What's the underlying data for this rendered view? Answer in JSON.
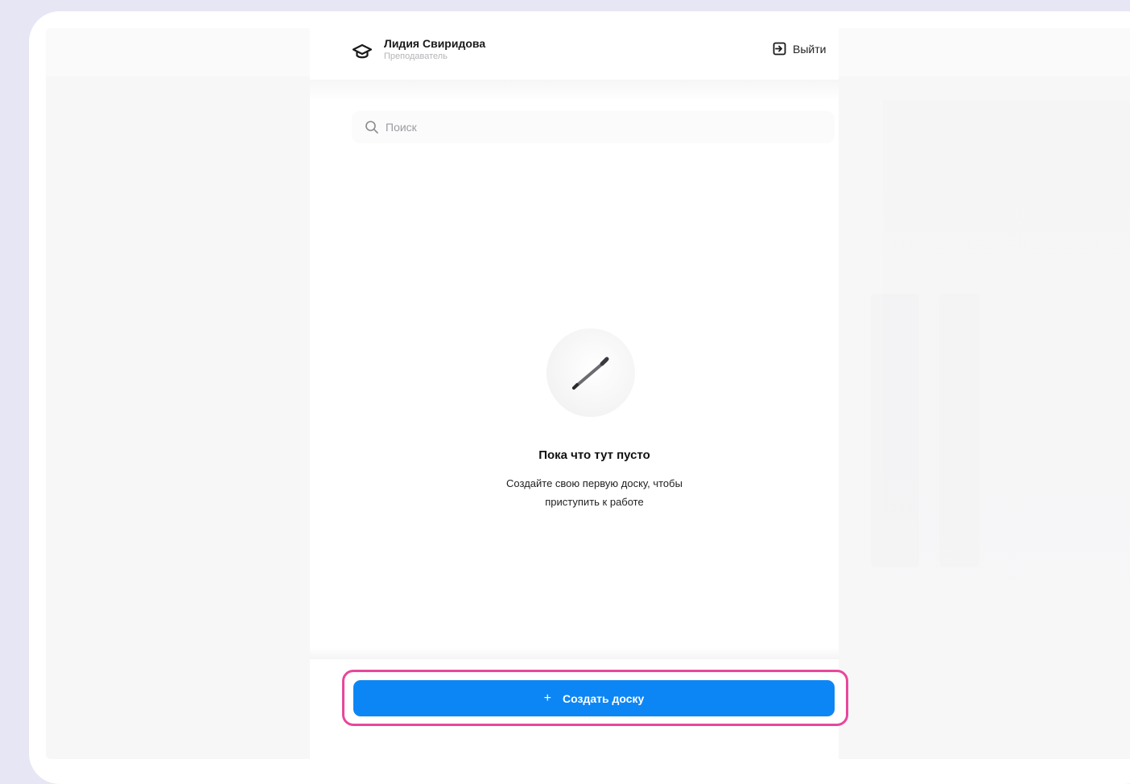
{
  "header": {
    "user_name": "Лидия Свиридова",
    "user_role": "Преподаватель",
    "logout_label": "Выйти"
  },
  "search": {
    "placeholder": "Поиск"
  },
  "empty_state": {
    "title": "Пока что тут пусто",
    "description_line1": "Создайте свою первую доску, чтобы",
    "description_line2": "приступить к работе"
  },
  "cta": {
    "icon": "+",
    "label": "Создать доску"
  },
  "colors": {
    "primary": "#0d86f5",
    "highlight": "#e8479b",
    "backdrop": "#e6e6f4"
  },
  "icons": {
    "user": "graduation-cap-icon",
    "logout": "logout-icon",
    "search": "search-icon",
    "empty": "pencil-icon",
    "add": "plus-icon"
  }
}
